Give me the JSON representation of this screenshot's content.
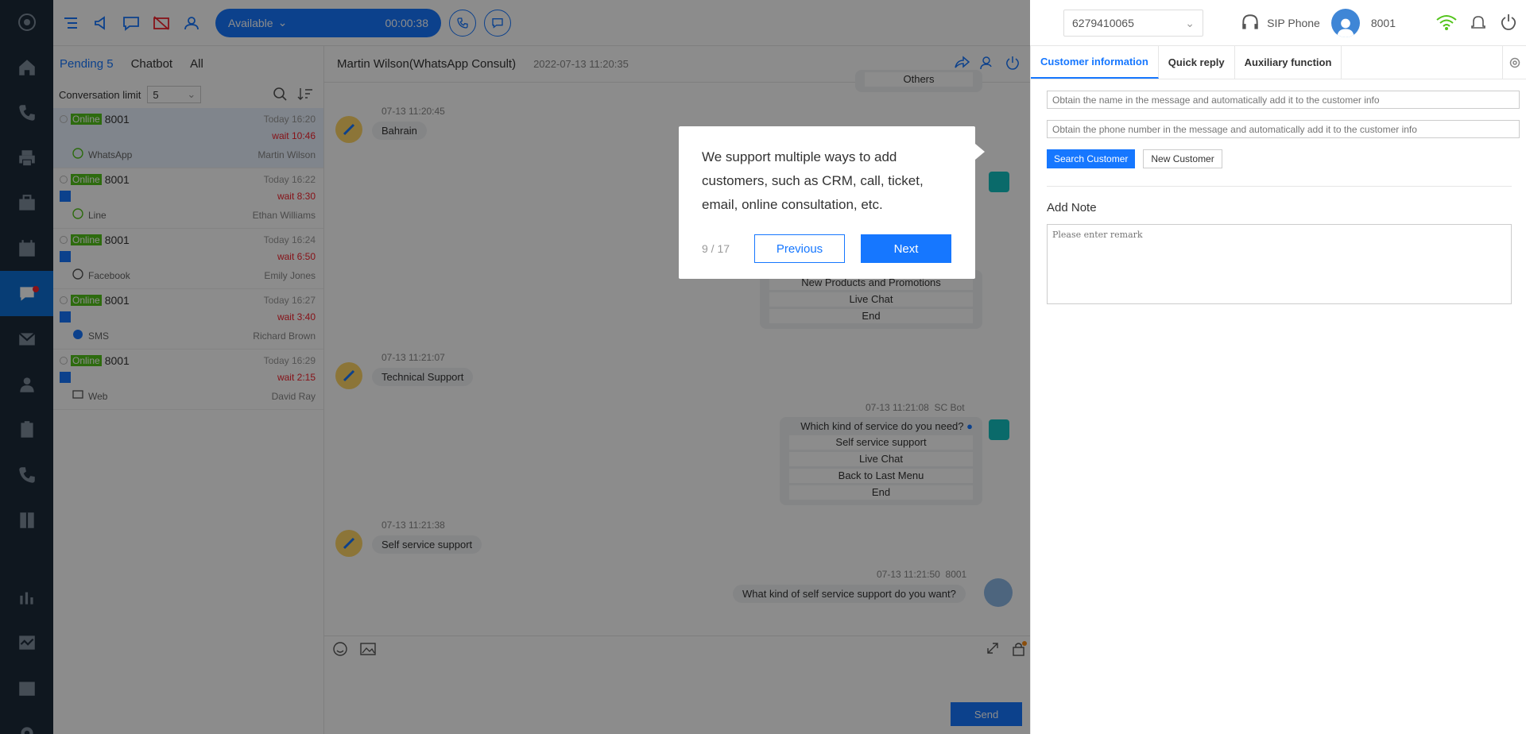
{
  "topbar": {
    "status": "Available",
    "timer": "00:00:38",
    "phone_number": "6279410065",
    "sip_label": "SIP Phone",
    "agent_ext": "8001"
  },
  "convlist": {
    "tabs": [
      "Pending 5",
      "Chatbot",
      "All"
    ],
    "limit_label": "Conversation limit",
    "limit_value": "5",
    "items": [
      {
        "status": "Online",
        "agent": "8001",
        "time": "Today 16:20",
        "wait": "wait 10:46",
        "channel": "WhatsApp",
        "customer": "Martin Wilson"
      },
      {
        "status": "Online",
        "agent": "8001",
        "time": "Today 16:22",
        "wait": "wait 8:30",
        "channel": "Line",
        "customer": "Ethan Williams"
      },
      {
        "status": "Online",
        "agent": "8001",
        "time": "Today 16:24",
        "wait": "wait 6:50",
        "channel": "Facebook",
        "customer": "Emily Jones"
      },
      {
        "status": "Online",
        "agent": "8001",
        "time": "Today 16:27",
        "wait": "wait 3:40",
        "channel": "SMS",
        "customer": "Richard Brown"
      },
      {
        "status": "Online",
        "agent": "8001",
        "time": "Today 16:29",
        "wait": "wait 2:15",
        "channel": "Web",
        "customer": "David Ray"
      }
    ]
  },
  "chat": {
    "title": "Martin Wilson(WhatsApp Consult)",
    "date": "2022-07-13 11:20:35",
    "others_opt": "Others",
    "msg1_time": "07-13 11:20:45",
    "msg1_text": "Bahrain",
    "menu1_opts": [
      "New Products and Promotions",
      "Live Chat",
      "End"
    ],
    "msg2_time": "07-13 11:21:07",
    "msg2_text": "Technical Support",
    "bot_time": "07-13 11:21:08",
    "bot_name": "SC Bot",
    "bot_question": "Which kind of service do you need?",
    "menu2_opts": [
      "Self service support",
      "Live Chat",
      "Back to Last Menu",
      "End"
    ],
    "msg3_time": "07-13 11:21:38",
    "msg3_text": "Self service support",
    "agent_time": "07-13 11:21:50",
    "agent_name": "8001",
    "agent_text": "What kind of self service support do you want?",
    "send": "Send"
  },
  "tour": {
    "text": "We support multiple ways to add customers, such as CRM, call, ticket, email, online consultation, etc.",
    "step": "9 / 17",
    "prev": "Previous",
    "next": "Next"
  },
  "rpanel": {
    "tabs": [
      "Customer information",
      "Quick reply",
      "Auxiliary function"
    ],
    "name_placeholder": "Obtain the name in the message and automatically add it to the customer info",
    "phone_placeholder": "Obtain the phone number in the message and automatically add it to the customer info",
    "search_btn": "Search Customer",
    "new_btn": "New Customer",
    "note_title": "Add Note",
    "note_placeholder": "Please enter remark"
  }
}
